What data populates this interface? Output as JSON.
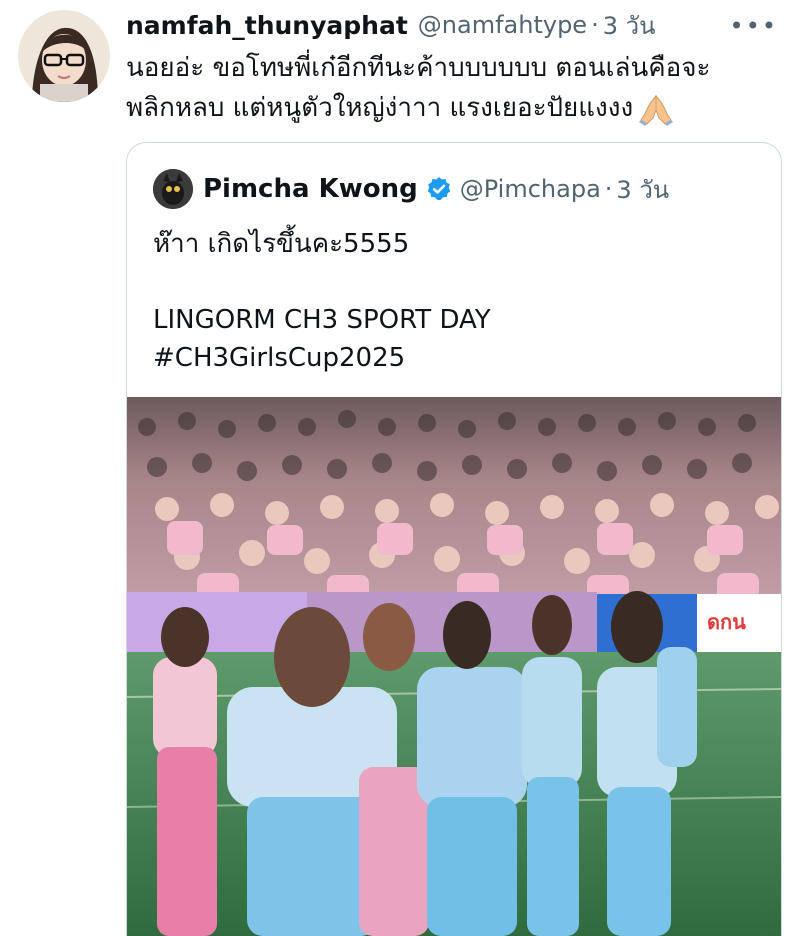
{
  "tweet": {
    "display_name": "namfah_thunyaphat",
    "handle": "@namfahtype",
    "separator": "·",
    "time": "3 วัน",
    "more": "•••",
    "lines": [
      "นอยอ่ะ ขอโทษพี่เก๋อีกทีนะค้าบบบบบบ ตอนเล่นคือจะ",
      "พลิกหลบ แต่หนูตัวใหญ่ง่าาา แรงเยอะปัยแงงง"
    ],
    "emoji": "folded-hands-emoji"
  },
  "quoted": {
    "display_name": "Pimcha Kwong",
    "handle": "@Pimchapa",
    "separator": "·",
    "time": "3 วัน",
    "lines": [
      "ห๊าา เกิดไรขึ้นคะ5555",
      "",
      "LINGORM CH3 SPORT DAY",
      "#CH3GirlsCup2025"
    ],
    "media_alt": "photo of players in pink and light blue uniforms huddled on a green court in front of a crowded stand"
  },
  "colors": {
    "text": "#0f1419",
    "secondary": "#536471",
    "border": "#cfd9de",
    "verified": "#1d9bf0",
    "court_green": "#3f7a4e",
    "jersey_blue": "#8fc7e8",
    "pants_pink": "#e77fa8"
  }
}
